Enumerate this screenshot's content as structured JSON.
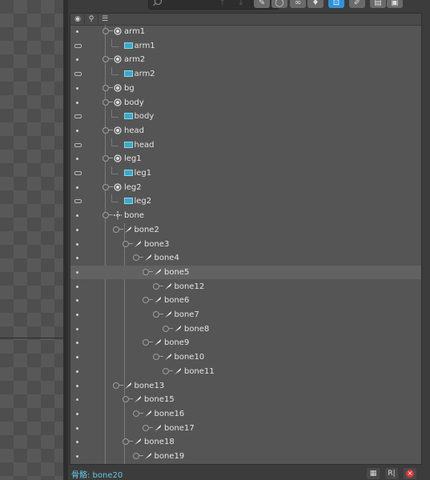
{
  "toolbar": {
    "search_placeholder": "",
    "buttons": [
      {
        "name": "arrow-up-icon",
        "glyph": "↑",
        "state": "dim"
      },
      {
        "name": "arrow-down-icon",
        "glyph": "↓",
        "state": "dim"
      },
      {
        "name": "bone-tool-icon",
        "glyph": "✎",
        "state": "normal"
      },
      {
        "name": "ring-tool-icon",
        "glyph": "◯",
        "state": "normal"
      },
      {
        "name": "link-tool-icon",
        "glyph": "∞",
        "state": "normal"
      },
      {
        "name": "pin-tool-icon",
        "glyph": "♦",
        "state": "normal"
      },
      {
        "name": "frame-tool-icon",
        "glyph": "⊡",
        "state": "active"
      },
      {
        "name": "paint-tool-icon",
        "glyph": "✐",
        "state": "normal"
      },
      {
        "name": "trash-icon",
        "glyph": "▤",
        "state": "normal"
      },
      {
        "name": "export-icon",
        "glyph": "▣",
        "state": "normal"
      }
    ]
  },
  "colors": {
    "accent": "#3192d8",
    "image_icon": "#3aa8c7",
    "status_text": "#63c7e6",
    "close_red": "#d8393a"
  },
  "tree": [
    {
      "label": "arm1",
      "icon": "slot-icon",
      "vis": "dot"
    },
    {
      "label": "arm1",
      "icon": "image-icon",
      "vis": "clip"
    },
    {
      "label": "arm2",
      "icon": "slot-icon",
      "vis": "dot"
    },
    {
      "label": "arm2",
      "icon": "image-icon",
      "vis": "clip"
    },
    {
      "label": "bg",
      "icon": "slot-icon",
      "vis": "dot"
    },
    {
      "label": "body",
      "icon": "slot-icon",
      "vis": "dot"
    },
    {
      "label": "body",
      "icon": "image-icon",
      "vis": "clip"
    },
    {
      "label": "head",
      "icon": "slot-icon",
      "vis": "dot"
    },
    {
      "label": "head",
      "icon": "image-icon",
      "vis": "clip"
    },
    {
      "label": "leg1",
      "icon": "slot-icon",
      "vis": "dot"
    },
    {
      "label": "leg1",
      "icon": "image-icon",
      "vis": "clip"
    },
    {
      "label": "leg2",
      "icon": "slot-icon",
      "vis": "dot"
    },
    {
      "label": "leg2",
      "icon": "image-icon",
      "vis": "clip"
    },
    {
      "label": "bone",
      "icon": "root-bone-icon",
      "vis": "dot"
    },
    {
      "label": "bone2",
      "icon": "bone-icon",
      "vis": "dot"
    },
    {
      "label": "bone3",
      "icon": "bone-icon",
      "vis": "dot"
    },
    {
      "label": "bone4",
      "icon": "bone-icon",
      "vis": "dot"
    },
    {
      "label": "bone5",
      "icon": "bone-icon",
      "vis": "dot",
      "selected": true
    },
    {
      "label": "bone12",
      "icon": "bone-icon",
      "vis": "dot"
    },
    {
      "label": "bone6",
      "icon": "bone-icon",
      "vis": "dot"
    },
    {
      "label": "bone7",
      "icon": "bone-icon",
      "vis": "dot"
    },
    {
      "label": "bone8",
      "icon": "bone-icon",
      "vis": "dot"
    },
    {
      "label": "bone9",
      "icon": "bone-icon",
      "vis": "dot"
    },
    {
      "label": "bone10",
      "icon": "bone-icon",
      "vis": "dot"
    },
    {
      "label": "bone11",
      "icon": "bone-icon",
      "vis": "dot"
    },
    {
      "label": "bone13",
      "icon": "bone-icon",
      "vis": "dot"
    },
    {
      "label": "bone15",
      "icon": "bone-icon",
      "vis": "dot"
    },
    {
      "label": "bone16",
      "icon": "bone-icon",
      "vis": "dot"
    },
    {
      "label": "bone17",
      "icon": "bone-icon",
      "vis": "dot"
    },
    {
      "label": "bone18",
      "icon": "bone-icon",
      "vis": "dot"
    },
    {
      "label": "bone19",
      "icon": "bone-icon",
      "vis": "dot"
    }
  ],
  "status": {
    "text": "骨骼: bone20",
    "buttons": [
      {
        "name": "paste-icon",
        "glyph": "▦"
      },
      {
        "name": "reset-icon",
        "glyph": "R|"
      },
      {
        "name": "close-icon",
        "glyph": "×"
      }
    ]
  }
}
